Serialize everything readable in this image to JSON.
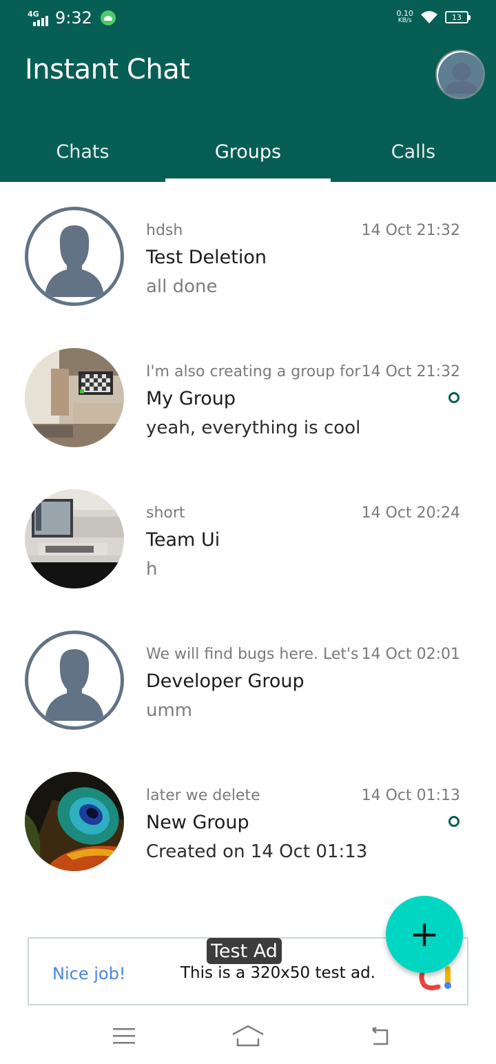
{
  "status_bar": {
    "network": "4G",
    "time": "9:32",
    "speed_value": "0.10",
    "speed_unit": "KB/s",
    "battery": "13"
  },
  "app": {
    "title": "Instant Chat",
    "brand_color": "#075e54",
    "fab_color": "#00d6c2"
  },
  "tabs": [
    {
      "label": "Chats",
      "active": false
    },
    {
      "label": "Groups",
      "active": true
    },
    {
      "label": "Calls",
      "active": false
    }
  ],
  "groups": [
    {
      "meta": "hdsh",
      "time": "14 Oct 21:32",
      "name": "Test Deletion",
      "message": "all done",
      "unread": false,
      "avatar": "default-person-icon"
    },
    {
      "meta": "I'm also creating a group for",
      "time": "14 Oct 21:32",
      "name": "My Group",
      "message": "yeah, everything is cool",
      "unread": true,
      "avatar": "room-photo"
    },
    {
      "meta": "short",
      "time": "14 Oct 20:24",
      "name": "Team Ui",
      "message": "h",
      "unread": false,
      "avatar": "monitor-photo"
    },
    {
      "meta": "We will find bugs here. Let's",
      "time": "14 Oct 02:01",
      "name": "Developer Group",
      "message": "umm",
      "unread": false,
      "avatar": "default-person-icon"
    },
    {
      "meta": "later we delete",
      "time": "14 Oct 01:13",
      "name": "New Group",
      "message": "Created on 14 Oct 01:13",
      "unread": true,
      "avatar": "peacock-feather-photo"
    }
  ],
  "fab": {
    "icon": "plus-icon",
    "label": "+"
  },
  "ad": {
    "tag": "Test Ad",
    "headline": "Nice job!",
    "body": "This is a 320x50 test ad."
  },
  "nav": {
    "menu": "menu-icon",
    "home": "home-icon",
    "back": "back-icon"
  }
}
